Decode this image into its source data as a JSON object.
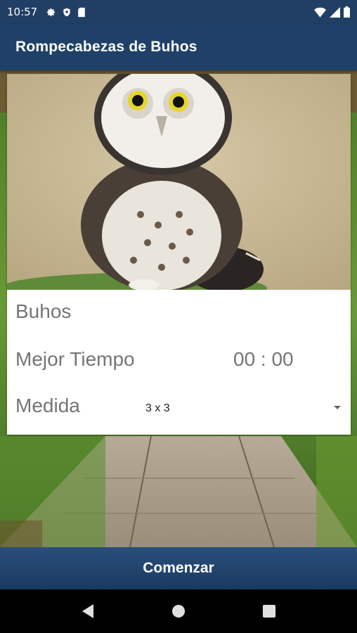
{
  "status_bar": {
    "time": "10:57",
    "left_icons": [
      "gear-icon",
      "shield-icon",
      "sd-card-icon"
    ],
    "right_icons": [
      "wifi-icon",
      "signal-icon",
      "battery-icon"
    ]
  },
  "app_bar": {
    "title": "Rompecabezas de Buhos"
  },
  "card": {
    "puzzle_name": "Buhos",
    "best_time_label": "Mejor Tiempo",
    "best_time_value": "00 : 00",
    "size_label": "Medida",
    "size_value": "3 x 3"
  },
  "start_button": {
    "label": "Comenzar"
  },
  "nav_bar": {
    "buttons": [
      "back-icon",
      "home-icon",
      "recents-icon"
    ]
  },
  "colors": {
    "primary": "#1f4168",
    "status_bar": "#213f64",
    "text_secondary": "#757575"
  }
}
